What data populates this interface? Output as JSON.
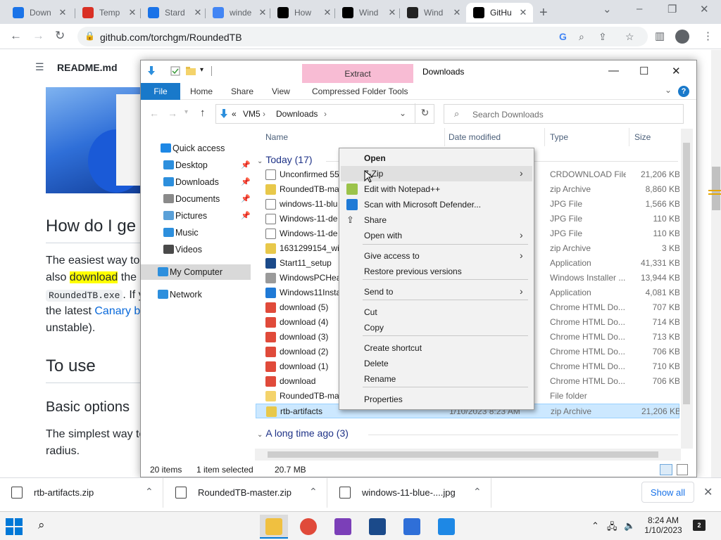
{
  "browser": {
    "tabs": [
      {
        "title": "Down",
        "favicon_color": "#1a73e8"
      },
      {
        "title": "Temp",
        "favicon_color": "#d93025"
      },
      {
        "title": "Stard",
        "favicon_color": "#1a73e8"
      },
      {
        "title": "winde",
        "favicon_color": "#4285f4"
      },
      {
        "title": "How",
        "favicon_color": "#000000"
      },
      {
        "title": "Wind",
        "favicon_color": "#000000"
      },
      {
        "title": "Wind",
        "favicon_color": "#222222"
      },
      {
        "title": "GitHu",
        "favicon_color": "#000000"
      }
    ],
    "active_tab": 7,
    "url": "github.com/torchgm/RoundedTB"
  },
  "page": {
    "readme_label": "README.md",
    "heading_how": "How do I ge",
    "para1": {
      "line1": "The easiest way to",
      "line2_pre": "also ",
      "line2_highlight": "download",
      "line2_post": " the",
      "line3_code": "RoundedTB.exe",
      "line3_post": ". If y",
      "line4_pre": "the latest ",
      "line4_link": "Canary b",
      "line5": "unstable)."
    },
    "heading_use": "To use",
    "heading_basic": "Basic options",
    "para2": {
      "line1": "The simplest way to",
      "line2": "radius."
    }
  },
  "explorer": {
    "title": "Downloads",
    "extract_tab": "Extract",
    "ribbon_tabs": [
      "File",
      "Home",
      "Share",
      "View",
      "Compressed Folder Tools"
    ],
    "breadcrumb": [
      "VM5",
      "Downloads"
    ],
    "breadcrumb_prefix": "«",
    "search_placeholder": "Search Downloads",
    "nav": [
      {
        "label": "Quick access",
        "icon": "star-icon",
        "color": "#1e88e5",
        "pinned": false
      },
      {
        "label": "Desktop",
        "icon": "desktop-icon",
        "color": "#2d8fdd",
        "pinned": true
      },
      {
        "label": "Downloads",
        "icon": "download-arrow-icon",
        "color": "#2d8fdd",
        "pinned": true
      },
      {
        "label": "Documents",
        "icon": "documents-icon",
        "color": "#8a8a8a",
        "pinned": true
      },
      {
        "label": "Pictures",
        "icon": "pictures-icon",
        "color": "#5aa0d8",
        "pinned": true
      },
      {
        "label": "Music",
        "icon": "music-icon",
        "color": "#2d8fdd",
        "pinned": false
      },
      {
        "label": "Videos",
        "icon": "videos-icon",
        "color": "#4a4a4a",
        "pinned": false
      },
      {
        "label": "My Computer",
        "icon": "computer-icon",
        "color": "#2d8fdd",
        "pinned": false
      },
      {
        "label": "Network",
        "icon": "network-icon",
        "color": "#2d8fdd",
        "pinned": false
      }
    ],
    "columns": [
      "Name",
      "Date modified",
      "Type",
      "Size"
    ],
    "group_today": "Today (17)",
    "group_long_ago": "A long time ago (3)",
    "files": [
      {
        "name": "Unconfirmed 55",
        "date": "",
        "type": "CRDOWNLOAD File",
        "size": "21,206 KB",
        "icon": "blank-file-icon",
        "color": "#ffffff"
      },
      {
        "name": "RoundedTB-ma",
        "date": "",
        "type": "zip Archive",
        "size": "8,860 KB",
        "icon": "zip-icon",
        "color": "#e8c84a"
      },
      {
        "name": "windows-11-blu",
        "date": "",
        "type": "JPG File",
        "size": "1,566 KB",
        "icon": "image-file-icon",
        "color": "#ffffff"
      },
      {
        "name": "Windows-11-de",
        "date": "",
        "type": "JPG File",
        "size": "110 KB",
        "icon": "image-file-icon",
        "color": "#ffffff"
      },
      {
        "name": "Windows-11-de",
        "date": "",
        "type": "JPG File",
        "size": "110 KB",
        "icon": "image-file-icon",
        "color": "#ffffff"
      },
      {
        "name": "1631299154_win",
        "date": "",
        "type": "zip Archive",
        "size": "3 KB",
        "icon": "zip-icon",
        "color": "#e8c84a"
      },
      {
        "name": "Start11_setup",
        "date": "",
        "type": "Application",
        "size": "41,331 KB",
        "icon": "app-icon",
        "color": "#1b4a8a"
      },
      {
        "name": "WindowsPCHea",
        "date": "",
        "type": "Windows Installer ...",
        "size": "13,944 KB",
        "icon": "installer-icon",
        "color": "#9a9a9a"
      },
      {
        "name": "Windows11Insta",
        "date": "",
        "type": "Application",
        "size": "4,081 KB",
        "icon": "windows-app-icon",
        "color": "#1f7ad6"
      },
      {
        "name": "download (5)",
        "date": "",
        "type": "Chrome HTML Do...",
        "size": "707 KB",
        "icon": "chrome-icon",
        "color": "#e04a3a"
      },
      {
        "name": "download (4)",
        "date": "",
        "type": "Chrome HTML Do...",
        "size": "714 KB",
        "icon": "chrome-icon",
        "color": "#e04a3a"
      },
      {
        "name": "download (3)",
        "date": "",
        "type": "Chrome HTML Do...",
        "size": "713 KB",
        "icon": "chrome-icon",
        "color": "#e04a3a"
      },
      {
        "name": "download (2)",
        "date": "",
        "type": "Chrome HTML Do...",
        "size": "706 KB",
        "icon": "chrome-icon",
        "color": "#e04a3a"
      },
      {
        "name": "download (1)",
        "date": "",
        "type": "Chrome HTML Do...",
        "size": "710 KB",
        "icon": "chrome-icon",
        "color": "#e04a3a"
      },
      {
        "name": "download",
        "date": "",
        "type": "Chrome HTML Do...",
        "size": "706 KB",
        "icon": "chrome-icon",
        "color": "#e04a3a"
      },
      {
        "name": "RoundedTB-ma",
        "date": "",
        "type": "File folder",
        "size": "",
        "icon": "folder-icon",
        "color": "#f4d36b"
      },
      {
        "name": "rtb-artifacts",
        "date": "1/10/2023 8:23 AM",
        "type": "zip Archive",
        "size": "21,206 KB",
        "icon": "zip-icon",
        "color": "#e8c84a"
      }
    ],
    "selected_file": 16,
    "status": {
      "count": "20 items",
      "selected": "1 item selected",
      "size": "20.7 MB"
    }
  },
  "context_menu": {
    "items": [
      {
        "label": "Open",
        "bold": true,
        "submenu": false,
        "icon": ""
      },
      {
        "label": "7-Zip",
        "bold": false,
        "submenu": true,
        "icon": ""
      },
      {
        "label": "Edit with Notepad++",
        "bold": false,
        "submenu": false,
        "icon": "notepadpp-icon"
      },
      {
        "label": "Scan with Microsoft Defender...",
        "bold": false,
        "submenu": false,
        "icon": "defender-icon"
      },
      {
        "label": "Share",
        "bold": false,
        "submenu": false,
        "icon": "share-icon"
      },
      {
        "label": "Open with",
        "bold": false,
        "submenu": true,
        "icon": ""
      },
      {
        "label": "Give access to",
        "bold": false,
        "submenu": true,
        "icon": ""
      },
      {
        "label": "Restore previous versions",
        "bold": false,
        "submenu": false,
        "icon": ""
      },
      {
        "label": "Send to",
        "bold": false,
        "submenu": true,
        "icon": ""
      },
      {
        "label": "Cut",
        "bold": false,
        "submenu": false,
        "icon": ""
      },
      {
        "label": "Copy",
        "bold": false,
        "submenu": false,
        "icon": ""
      },
      {
        "label": "Create shortcut",
        "bold": false,
        "submenu": false,
        "icon": ""
      },
      {
        "label": "Delete",
        "bold": false,
        "submenu": false,
        "icon": ""
      },
      {
        "label": "Rename",
        "bold": false,
        "submenu": false,
        "icon": ""
      },
      {
        "label": "Properties",
        "bold": false,
        "submenu": false,
        "icon": ""
      }
    ],
    "hovered": 1
  },
  "downloads_shelf": {
    "items": [
      "rtb-artifacts.zip",
      "RoundedTB-master.zip",
      "windows-11-blue-....jpg"
    ],
    "show_all": "Show all"
  },
  "taskbar": {
    "apps": [
      {
        "name": "file-explorer-icon",
        "color": "#f0c040",
        "active": true
      },
      {
        "name": "chrome-icon",
        "color": "#e04a3a",
        "active": false
      },
      {
        "name": "visual-studio-icon",
        "color": "#7b3fb8",
        "active": false
      },
      {
        "name": "start11-icon",
        "color": "#1b4a8a",
        "active": false
      },
      {
        "name": "vector-app-icon",
        "color": "#2f6fd8",
        "active": false
      },
      {
        "name": "photos-icon",
        "color": "#1e88e5",
        "active": false
      }
    ],
    "time": "8:24 AM",
    "date": "1/10/2023",
    "notification_count": "2"
  },
  "colors": {
    "accent": "#1979ca",
    "selection": "#cce8ff",
    "extract_tab": "#f8bcd4",
    "highlight": "#ffff00",
    "link": "#0969da"
  }
}
